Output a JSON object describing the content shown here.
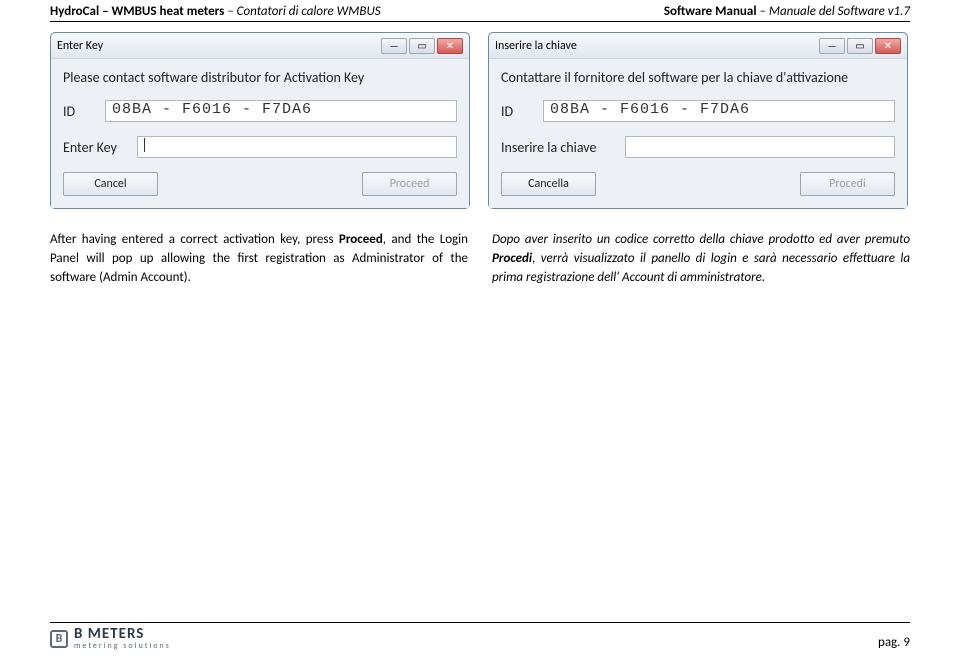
{
  "header": {
    "left_bold": "HydroCal – WMBUS heat meters",
    "left_italic": " – Contatori di calore WMBUS",
    "right_bold": "Software Manual",
    "right_italic": " – Manuale del Software v1.7"
  },
  "dialogs": {
    "en": {
      "title": "Enter Key",
      "message": "Please contact software distributor for Activation Key",
      "id_label": "ID",
      "id_value": "08BA - F6016 - F7DA6",
      "key_label": "Enter Key",
      "key_value": "",
      "cancel": "Cancel",
      "proceed": "Proceed"
    },
    "it": {
      "title": "Inserire la chiave",
      "message": "Contattare il fornitore del software per la chiave d'attivazione",
      "id_label": "ID",
      "id_value": "08BA - F6016 - F7DA6",
      "key_label": "Inserire la chiave",
      "key_value": "",
      "cancel": "Cancella",
      "proceed": "Procedi"
    }
  },
  "body": {
    "en_pre": "After having entered a correct activation key, press ",
    "en_bold": "Proceed",
    "en_post": ", and the Login Panel will pop up allowing the first registration as Administrator of the software (Admin Account).",
    "it_pre": "Dopo aver inserito un codice corretto della chiave prodotto ed aver premuto ",
    "it_bold": "Procedi",
    "it_post": ", verrà visualizzato il panello di login e sarà necessario effettuare la prima registrazione dell' Account di amministratore."
  },
  "footer": {
    "logo_big": "B METERS",
    "logo_small": "metering solutions",
    "page": "pag. 9"
  },
  "window_controls": {
    "min": "—",
    "max": "▭",
    "close": "✕"
  }
}
